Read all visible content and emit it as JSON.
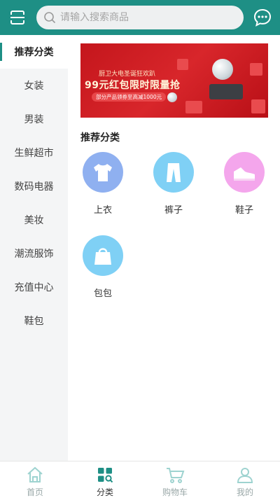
{
  "header": {
    "search_placeholder": "请输入搜索商品",
    "left_icon": "scan-menu-icon",
    "right_icon": "message-icon",
    "color": "#1e8f85"
  },
  "sidebar": {
    "items": [
      {
        "label": "推荐分类",
        "active": true
      },
      {
        "label": "女装"
      },
      {
        "label": "男装"
      },
      {
        "label": "生鲜超市"
      },
      {
        "label": "数码电器"
      },
      {
        "label": "美妆"
      },
      {
        "label": "潮流服饰"
      },
      {
        "label": "充值中心"
      },
      {
        "label": "鞋包"
      }
    ]
  },
  "banner": {
    "line1": "厨卫大电圣诞狂欢趴",
    "line2": "99元红包限时限量抢",
    "line3": "部分产品领券至高减1000元"
  },
  "main": {
    "section_title": "推荐分类",
    "categories": [
      {
        "label": "上衣",
        "icon": "shirt-icon",
        "color": "#8fb0f0"
      },
      {
        "label": "裤子",
        "icon": "pants-icon",
        "color": "#7fd0f5"
      },
      {
        "label": "鞋子",
        "icon": "shoe-icon",
        "color": "#f4a6ec"
      },
      {
        "label": "包包",
        "icon": "bag-icon",
        "color": "#7fd0f5"
      }
    ]
  },
  "tabbar": {
    "tabs": [
      {
        "label": "首页",
        "icon": "home-icon"
      },
      {
        "label": "分类",
        "icon": "category-icon",
        "active": true
      },
      {
        "label": "购物车",
        "icon": "cart-icon"
      },
      {
        "label": "我的",
        "icon": "user-icon"
      }
    ]
  }
}
